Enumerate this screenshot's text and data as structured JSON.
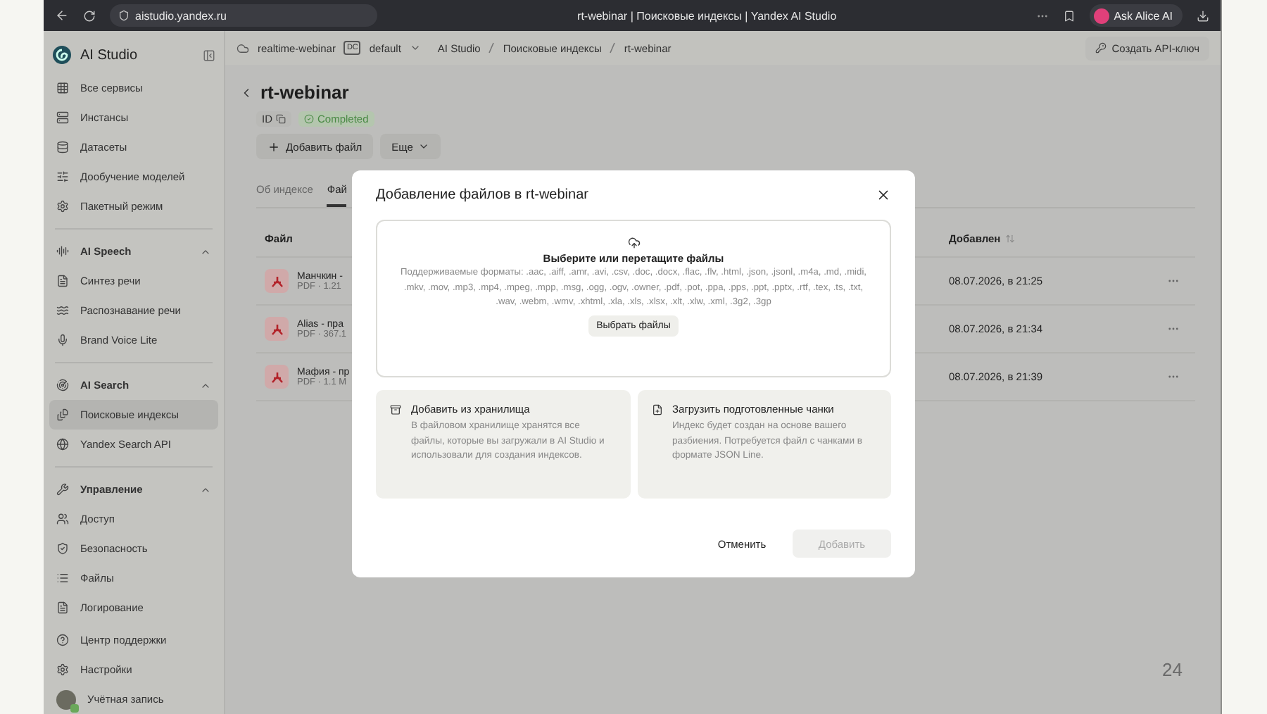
{
  "browser": {
    "url": "aistudio.yandex.ru",
    "tab_title": "rt-webinar | Поисковые индексы | Yandex AI Studio",
    "assistant_button": "Ask Alice AI"
  },
  "sidebar": {
    "title": "AI Studio",
    "top_items": [
      {
        "label": "Все сервисы",
        "selected": false
      },
      {
        "label": "Инстансы",
        "selected": false
      },
      {
        "label": "Датасеты",
        "selected": false
      },
      {
        "label": "Дообучение моделей",
        "selected": false
      },
      {
        "label": "Пакетный режим",
        "selected": false
      }
    ],
    "groups": [
      {
        "title": "AI Speech",
        "expanded": true,
        "items": [
          {
            "label": "Синтез речи",
            "selected": false
          },
          {
            "label": "Распознавание речи",
            "selected": false
          },
          {
            "label": "Brand Voice Lite",
            "selected": false
          }
        ]
      },
      {
        "title": "AI Search",
        "expanded": true,
        "items": [
          {
            "label": "Поисковые индексы",
            "selected": true
          },
          {
            "label": "Yandex Search API",
            "selected": false
          }
        ]
      },
      {
        "title": "Управление",
        "expanded": true,
        "items": [
          {
            "label": "Доступ",
            "selected": false
          },
          {
            "label": "Безопасность",
            "selected": false
          },
          {
            "label": "Файлы",
            "selected": false
          },
          {
            "label": "Логирование",
            "selected": false
          }
        ]
      }
    ],
    "footer_items": [
      {
        "label": "Центр поддержки"
      },
      {
        "label": "Настройки"
      },
      {
        "label": "Учётная запись"
      }
    ]
  },
  "topbar": {
    "cloud": "realtime-webinar",
    "folder_badge": "DC",
    "folder": "default",
    "breadcrumbs": [
      "AI Studio",
      "Поисковые индексы",
      "rt-webinar"
    ],
    "api_key_button": "Создать API-ключ"
  },
  "page": {
    "title": "rt-webinar",
    "id_label": "ID",
    "status": "Completed",
    "add_button": "Добавить файл",
    "more_button": "Еще",
    "tabs": [
      {
        "label": "Об индексе",
        "selected": false
      },
      {
        "label": "Фай",
        "selected": true
      }
    ],
    "columns": [
      "Файл",
      "Добавлен"
    ],
    "rows": [
      {
        "name": "Манчкин -",
        "meta": "PDF · 1.21",
        "added": "08.07.2026, в 21:25"
      },
      {
        "name": "Alias - пра",
        "meta": "PDF · 367.1",
        "added": "08.07.2026, в 21:34"
      },
      {
        "name": "Мафия - пр",
        "meta": "PDF · 1.1 M",
        "added": "08.07.2026, в 21:39"
      }
    ]
  },
  "modal": {
    "title": "Добавление файлов в rt-webinar",
    "dropzone": {
      "title": "Выберите или перетащите файлы",
      "formats": "Поддерживаемые форматы: .aac, .aiff, .amr, .avi, .csv, .doc, .docx, .flac, .flv, .html, .json, .jsonl, .m4a, .md, .midi, .mkv, .mov, .mp3, .mp4, .mpeg, .mpp, .msg, .ogg, .ogv, .owner, .pdf, .pot, .ppa, .pps, .ppt, .pptx, .rtf, .tex, .ts, .txt, .wav, .webm, .wmv, .xhtml, .xla, .xls, .xlsx, .xlt, .xlw, .xml, .3g2, .3gp",
      "button": "Выбрать файлы"
    },
    "options": [
      {
        "title": "Добавить из хранилища",
        "description": "В файловом хранилище хранятся все файлы, которые вы загружали в AI Studio и использовали для создания индексов."
      },
      {
        "title": "Загрузить подготовленные чанки",
        "description": "Индекс будет создан на основе вашего разбиения. Потребуется файл с чанками в формате JSON Line."
      }
    ],
    "cancel_button": "Отменить",
    "submit_button": {
      "label": "Добавить",
      "disabled": true
    }
  },
  "slide_number": "24"
}
